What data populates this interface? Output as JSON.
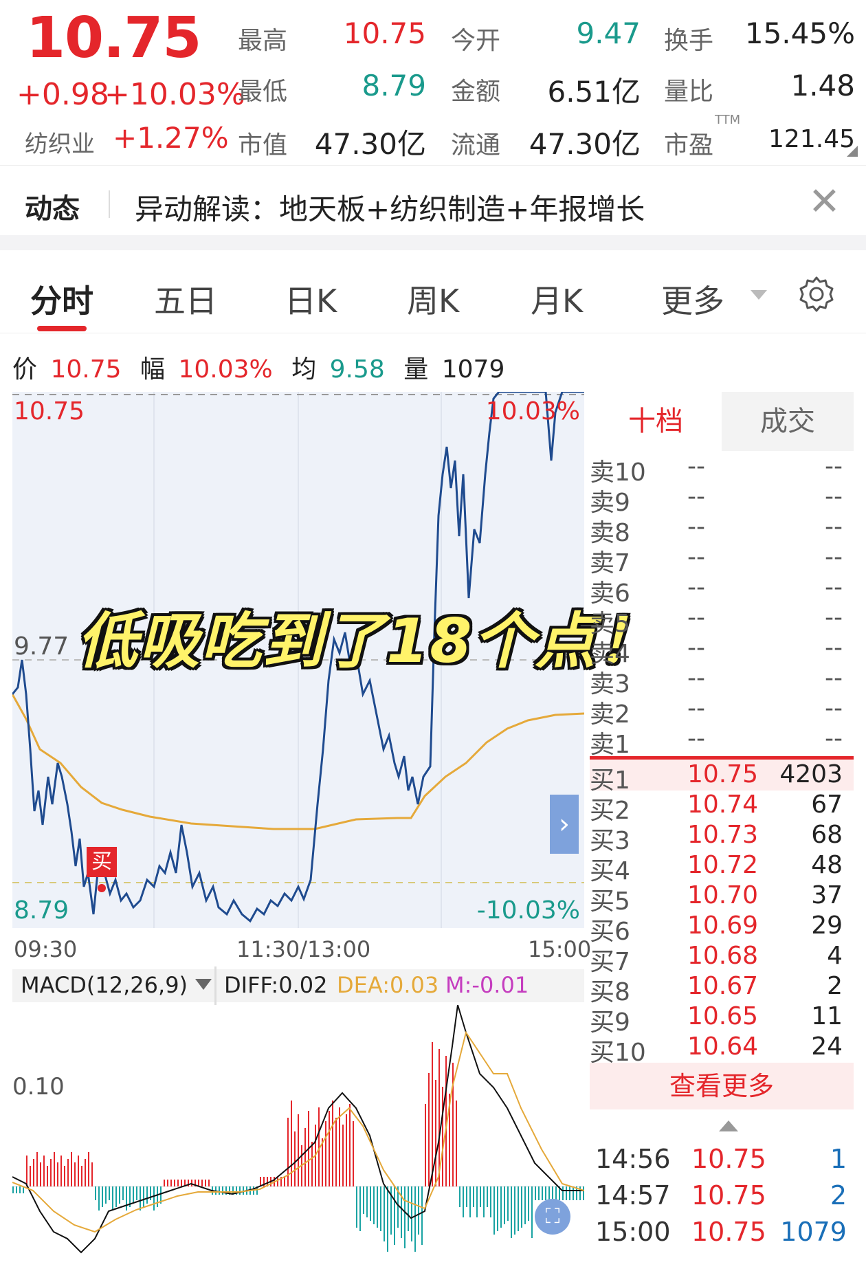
{
  "quote": {
    "price": "10.75",
    "change": "+0.98",
    "change_pct": "+10.03%",
    "industry_label": "纺织业",
    "industry_pct": "+1.27%",
    "stats": [
      {
        "label": "最高",
        "value": "10.75",
        "color": "red"
      },
      {
        "label": "今开",
        "value": "9.47",
        "color": "green"
      },
      {
        "label": "换手",
        "value": "15.45%",
        "color": "dark"
      },
      {
        "label": "最低",
        "value": "8.79",
        "color": "green"
      },
      {
        "label": "金额",
        "value": "6.51亿",
        "color": "dark"
      },
      {
        "label": "量比",
        "value": "1.48",
        "color": "dark"
      },
      {
        "label": "市值",
        "value": "47.30亿",
        "color": "dark"
      },
      {
        "label": "流通",
        "value": "47.30亿",
        "color": "dark"
      },
      {
        "label": "市盈",
        "value": "121.45",
        "color": "dark"
      }
    ],
    "ttm_label": "TTM"
  },
  "notice": {
    "title": "动态",
    "text": "异动解读：地天板+纺织制造+年报增长",
    "close_glyph": "✕"
  },
  "tabs": [
    "分时",
    "五日",
    "日K",
    "周K",
    "月K",
    "更多"
  ],
  "info_line": {
    "price_label": "价",
    "price": "10.75",
    "amp_label": "幅",
    "amp": "10.03%",
    "avg_label": "均",
    "avg": "9.58",
    "vol_label": "量",
    "vol": "1079"
  },
  "chart": {
    "y_top": "10.75",
    "y_mid": "9.77",
    "y_bottom": "8.79",
    "pct_top": "10.03%",
    "pct_bottom": "-10.03%",
    "time_start": "09:30",
    "time_mid": "11:30/13:00",
    "time_end": "15:00",
    "buy_marker": "买",
    "overlay": "低吸吃到了18个点！"
  },
  "macd": {
    "label": "MACD(12,26,9)",
    "diff": "DIFF:0.02",
    "dea": "DEA:0.03",
    "m": "M:-0.01",
    "y_label": "0.10"
  },
  "chart_data": {
    "type": "line",
    "title": "",
    "x": [
      "09:30",
      "11:30/13:00",
      "15:00"
    ],
    "ylim": [
      8.79,
      10.75
    ],
    "reference": 9.77,
    "series": [],
    "colors": {
      "price": "#1f4b8f",
      "avg": "#e5a93a",
      "up": "#e4262b",
      "down": "#1aa3a3"
    }
  },
  "order_book": {
    "tab_active": "十档",
    "tab_other": "成交",
    "sells": [
      {
        "label": "卖10",
        "price": "--",
        "vol": "--"
      },
      {
        "label": "卖9",
        "price": "--",
        "vol": "--"
      },
      {
        "label": "卖8",
        "price": "--",
        "vol": "--"
      },
      {
        "label": "卖7",
        "price": "--",
        "vol": "--"
      },
      {
        "label": "卖6",
        "price": "--",
        "vol": "--"
      },
      {
        "label": "卖5",
        "price": "--",
        "vol": "--"
      },
      {
        "label": "卖4",
        "price": "--",
        "vol": "--"
      },
      {
        "label": "卖3",
        "price": "--",
        "vol": "--"
      },
      {
        "label": "卖2",
        "price": "--",
        "vol": "--"
      },
      {
        "label": "卖1",
        "price": "--",
        "vol": "--"
      }
    ],
    "buys": [
      {
        "label": "买1",
        "price": "10.75",
        "vol": "4203"
      },
      {
        "label": "买2",
        "price": "10.74",
        "vol": "67"
      },
      {
        "label": "买3",
        "price": "10.73",
        "vol": "68"
      },
      {
        "label": "买4",
        "price": "10.72",
        "vol": "48"
      },
      {
        "label": "买5",
        "price": "10.70",
        "vol": "37"
      },
      {
        "label": "买6",
        "price": "10.69",
        "vol": "29"
      },
      {
        "label": "买7",
        "price": "10.68",
        "vol": "4"
      },
      {
        "label": "买8",
        "price": "10.67",
        "vol": "2"
      },
      {
        "label": "买9",
        "price": "10.65",
        "vol": "11"
      },
      {
        "label": "买10",
        "price": "10.64",
        "vol": "24"
      }
    ],
    "more_label": "查看更多",
    "trades": [
      {
        "time": "14:56",
        "price": "10.75",
        "vol": "1"
      },
      {
        "time": "14:57",
        "price": "10.75",
        "vol": "2"
      },
      {
        "time": "15:00",
        "price": "10.75",
        "vol": "1079"
      }
    ]
  }
}
